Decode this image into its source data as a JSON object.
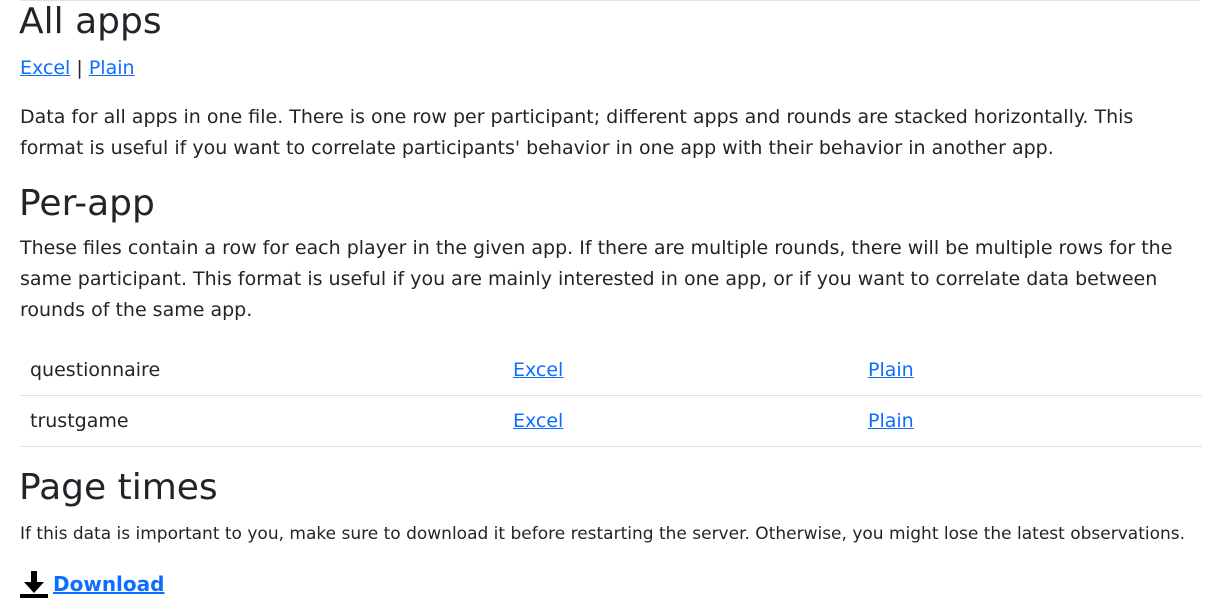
{
  "all_apps": {
    "heading": "All apps",
    "excel_link": "Excel",
    "separator": "|",
    "plain_link": "Plain",
    "description": "Data for all apps in one file. There is one row per participant; different apps and rounds are stacked horizontally. This format is useful if you want to correlate participants' behavior in one app with their behavior in another app."
  },
  "per_app": {
    "heading": "Per-app",
    "description": "These files contain a row for each player in the given app. If there are multiple rounds, there will be multiple rows for the same participant. This format is useful if you are mainly interested in one app, or if you want to correlate data between rounds of the same app.",
    "rows": [
      {
        "app": "questionnaire",
        "excel": "Excel",
        "plain": "Plain"
      },
      {
        "app": "trustgame",
        "excel": "Excel",
        "plain": "Plain"
      }
    ]
  },
  "page_times": {
    "heading": "Page times",
    "note": "If this data is important to you, make sure to download it before restarting the server. Otherwise, you might lose the latest observations.",
    "download_label": "Download",
    "download_icon": "download-icon"
  },
  "colors": {
    "link": "#0d6efd",
    "text": "#212529",
    "divider": "#dee2e6"
  }
}
